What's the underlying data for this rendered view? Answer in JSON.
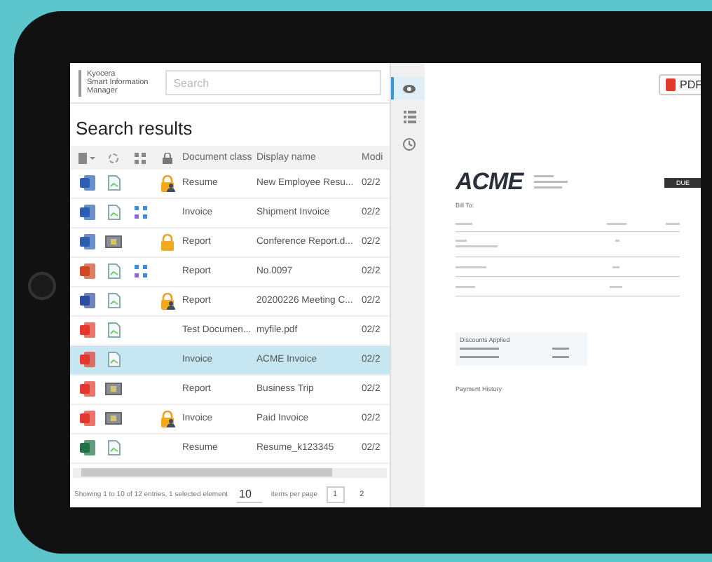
{
  "brand": {
    "lines": [
      "Kyocera",
      "Smart Information",
      "Manager"
    ]
  },
  "search": {
    "placeholder": "Search"
  },
  "heading": "Search results",
  "columns": [
    {
      "kind": "file-menu"
    },
    {
      "kind": "sync"
    },
    {
      "kind": "grid"
    },
    {
      "kind": "lock"
    },
    {
      "kind": "text",
      "label": "Document class"
    },
    {
      "kind": "text",
      "label": "Display name"
    },
    {
      "kind": "text",
      "label": "Modi"
    }
  ],
  "rows": [
    {
      "file_icon": {
        "kind": "word"
      },
      "status_icon": {
        "kind": "page"
      },
      "linked": false,
      "lock_icon": {
        "kind": "user"
      },
      "class": "Resume",
      "name": "New Employee Resu...",
      "date": "02/2",
      "selected": false
    },
    {
      "file_icon": {
        "kind": "word"
      },
      "status_icon": {
        "kind": "page"
      },
      "linked": true,
      "lock_icon": {
        "kind": "none"
      },
      "class": "Invoice",
      "name": "Shipment Invoice",
      "date": "02/2",
      "selected": false
    },
    {
      "file_icon": {
        "kind": "word"
      },
      "status_icon": {
        "kind": "scan"
      },
      "linked": false,
      "lock_icon": {
        "kind": "plain"
      },
      "class": "Report",
      "name": "Conference Report.d...",
      "date": "02/2",
      "selected": false
    },
    {
      "file_icon": {
        "kind": "powerpoint"
      },
      "status_icon": {
        "kind": "page"
      },
      "linked": true,
      "lock_icon": {
        "kind": "none"
      },
      "class": "Report",
      "name": "No.0097",
      "date": "02/2",
      "selected": false
    },
    {
      "file_icon": {
        "kind": "text"
      },
      "status_icon": {
        "kind": "page"
      },
      "linked": false,
      "lock_icon": {
        "kind": "user"
      },
      "class": "Report",
      "name": "20200226 Meeting C...",
      "date": "02/2",
      "selected": false
    },
    {
      "file_icon": {
        "kind": "pdf"
      },
      "status_icon": {
        "kind": "page"
      },
      "linked": false,
      "lock_icon": {
        "kind": "none"
      },
      "class": "Test Documen...",
      "name": "myfile.pdf",
      "date": "02/2",
      "selected": false
    },
    {
      "file_icon": {
        "kind": "pdf"
      },
      "status_icon": {
        "kind": "page"
      },
      "linked": false,
      "lock_icon": {
        "kind": "none"
      },
      "class": "Invoice",
      "name": "ACME Invoice",
      "date": "02/2",
      "selected": true
    },
    {
      "file_icon": {
        "kind": "pdf"
      },
      "status_icon": {
        "kind": "scan"
      },
      "linked": false,
      "lock_icon": {
        "kind": "none"
      },
      "class": "Report",
      "name": "Business Trip",
      "date": "02/2",
      "selected": false
    },
    {
      "file_icon": {
        "kind": "pdf"
      },
      "status_icon": {
        "kind": "scan"
      },
      "linked": false,
      "lock_icon": {
        "kind": "user"
      },
      "class": "Invoice",
      "name": "Paid Invoice",
      "date": "02/2",
      "selected": false
    },
    {
      "file_icon": {
        "kind": "excel"
      },
      "status_icon": {
        "kind": "page"
      },
      "linked": false,
      "lock_icon": {
        "kind": "none"
      },
      "class": "Resume",
      "name": "Resume_k123345",
      "date": "02/2",
      "selected": false
    }
  ],
  "footer": {
    "summary": "Showing 1 to 10 of 12 entries, 1 selected element",
    "page_size": "10",
    "page_size_label": "items per page",
    "pages": [
      {
        "label": "1",
        "selected": true
      },
      {
        "label": "2",
        "selected": false
      }
    ]
  },
  "side_tools": [
    {
      "kind": "eye",
      "selected": true
    },
    {
      "kind": "list",
      "selected": false
    },
    {
      "kind": "history",
      "selected": false
    }
  ],
  "preview": {
    "pdf_button": "PDF",
    "logo": "ACME",
    "bill_to": "Bill To:",
    "due": "DUE",
    "discounts": "Discounts Applied",
    "payment_history": "Payment History"
  }
}
